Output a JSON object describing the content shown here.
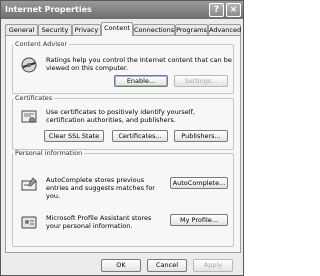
{
  "window": {
    "title": "Internet Properties",
    "help_label": "?",
    "close_label": "×"
  },
  "tabs": [
    {
      "label": "General"
    },
    {
      "label": "Security"
    },
    {
      "label": "Privacy"
    },
    {
      "label": "Content",
      "active": true
    },
    {
      "label": "Connections"
    },
    {
      "label": "Programs"
    },
    {
      "label": "Advanced"
    }
  ],
  "content_advisor": {
    "title": "Content Advisor",
    "text": "Ratings help you control the Internet content that can be viewed on this computer.",
    "enable_label": "Enable...",
    "settings_label": "Settings..."
  },
  "certificates": {
    "title": "Certificates",
    "text": "Use certificates to positively identify yourself, certification authorities, and publishers.",
    "clear_ssl_label": "Clear SSL State",
    "certificates_label": "Certificates...",
    "publishers_label": "Publishers..."
  },
  "personal_info": {
    "title": "Personal information",
    "autocomplete_text": "AutoComplete stores previous entries and suggests matches for you.",
    "autocomplete_label": "AutoComplete...",
    "profile_text": "Microsoft Profile Assistant stores your personal information.",
    "profile_label": "My Profile..."
  },
  "footer": {
    "ok_label": "OK",
    "cancel_label": "Cancel",
    "apply_label": "Apply"
  }
}
